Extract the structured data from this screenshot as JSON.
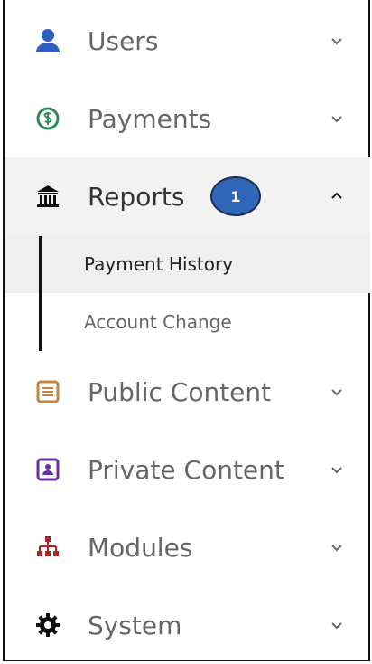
{
  "nav": {
    "items": [
      {
        "label": "Users",
        "icon": "user-icon"
      },
      {
        "label": "Payments",
        "icon": "dollar-circle-icon"
      },
      {
        "label": "Reports",
        "icon": "bank-icon",
        "badge": "1"
      },
      {
        "label": "Public Content",
        "icon": "document-icon"
      },
      {
        "label": "Private Content",
        "icon": "id-card-icon"
      },
      {
        "label": "Modules",
        "icon": "sitemap-icon"
      },
      {
        "label": "System",
        "icon": "gear-icon"
      }
    ],
    "reports_subitems": [
      {
        "label": "Payment History"
      },
      {
        "label": "Account Change"
      }
    ]
  },
  "colors": {
    "users": "#2f5fbf",
    "payments": "#2e8b57",
    "reports": "#111111",
    "public_content": "#c8843a",
    "private_content": "#6a2fa0",
    "modules": "#b22222",
    "system": "#111111",
    "badge": "#2f66b8"
  }
}
